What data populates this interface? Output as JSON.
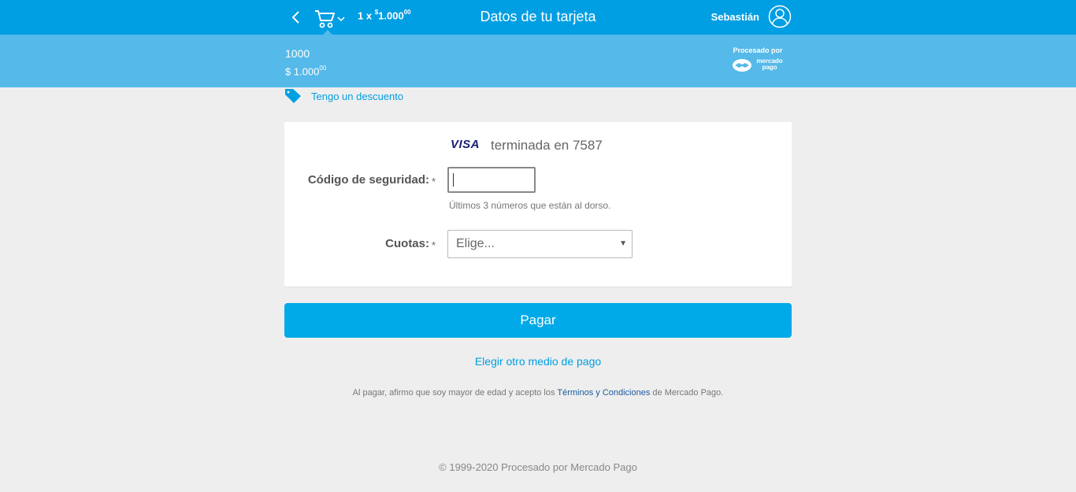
{
  "header": {
    "title": "Datos de tu tarjeta",
    "cart_summary": "1 x",
    "cart_currency": "$",
    "cart_amount": "1.000",
    "cart_cents": "00",
    "user_name": "Sebastián"
  },
  "subheader": {
    "item_title": "1000",
    "amount": "$ 1.000",
    "amount_cents": "00",
    "processed_by": "Procesado por",
    "brand_line1": "mercado",
    "brand_line2": "pago"
  },
  "discount": {
    "label": "Tengo un descuento"
  },
  "card": {
    "brand": "VISA",
    "ending_text": "terminada en 7587"
  },
  "form": {
    "cvv_label": "Código de seguridad:",
    "cvv_value": "",
    "cvv_hint": "Últimos 3 números que están al dorso.",
    "cuotas_label": "Cuotas:",
    "cuotas_selected": "Elige...",
    "required_mark": "*"
  },
  "actions": {
    "pay_label": "Pagar",
    "other_method_label": "Elegir otro medio de pago"
  },
  "legal": {
    "prefix": "Al pagar, afirmo que soy mayor de edad y acepto los",
    "link": "Términos y Condiciones",
    "suffix": "de Mercado Pago."
  },
  "footer": {
    "text": "© 1999-2020 Procesado por Mercado Pago"
  },
  "colors": {
    "primary": "#009ee3",
    "subheader": "#55b9e9",
    "button": "#00a9e8",
    "background": "#eeeeee"
  }
}
